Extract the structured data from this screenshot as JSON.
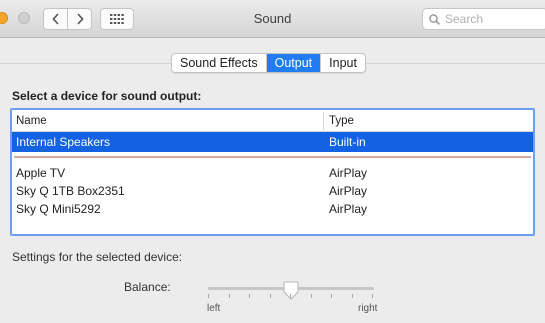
{
  "window": {
    "title": "Sound",
    "search_placeholder": "Search",
    "icons": {
      "close": "close-light-icon",
      "minimize": "minimize-light-icon",
      "back": "chevron-left-icon",
      "forward": "chevron-right-icon",
      "grid": "grid-icon",
      "search": "search-icon",
      "knob": "slider-knob-icon"
    },
    "colors": {
      "accent": "#1f7cf2",
      "selection": "#1262e3",
      "table_focus": "#6ea0f2"
    }
  },
  "tabs": [
    {
      "label": "Sound Effects",
      "active": false
    },
    {
      "label": "Output",
      "active": true
    },
    {
      "label": "Input",
      "active": false
    }
  ],
  "output": {
    "section_title": "Select a device for sound output:",
    "columns": [
      "Name",
      "Type"
    ],
    "rows": [
      {
        "name": "Internal Speakers",
        "type": "Built-in",
        "selected": true
      },
      {
        "name": "Apple TV",
        "type": "AirPlay",
        "selected": false
      },
      {
        "name": "Sky Q 1TB Box2351",
        "type": "AirPlay",
        "selected": false
      },
      {
        "name": "Sky Q Mini5292",
        "type": "AirPlay",
        "selected": false
      }
    ]
  },
  "settings": {
    "heading": "Settings for the selected device:",
    "balance_label": "Balance:",
    "balance_value": 0.5,
    "balance_min_label": "left",
    "balance_max_label": "right"
  }
}
